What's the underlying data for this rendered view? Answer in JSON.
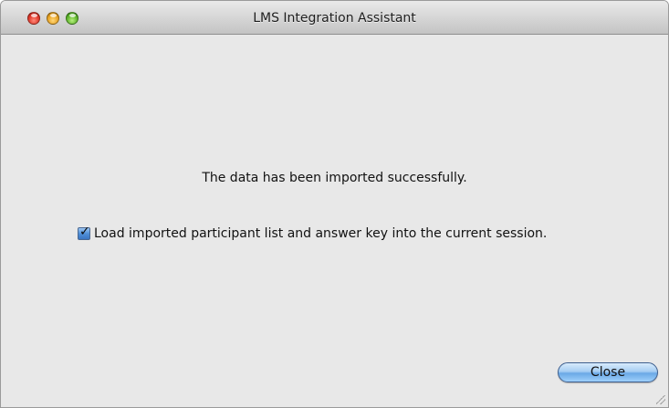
{
  "window": {
    "title": "LMS Integration Assistant"
  },
  "main": {
    "message": "The data has been imported successfully.",
    "option": {
      "label": "Load imported participant list and answer key into the current session.",
      "checked": true
    },
    "close_label": "Close"
  },
  "colors": {
    "accent": "#4f8fd8",
    "window_bg": "#e8e8e8"
  }
}
